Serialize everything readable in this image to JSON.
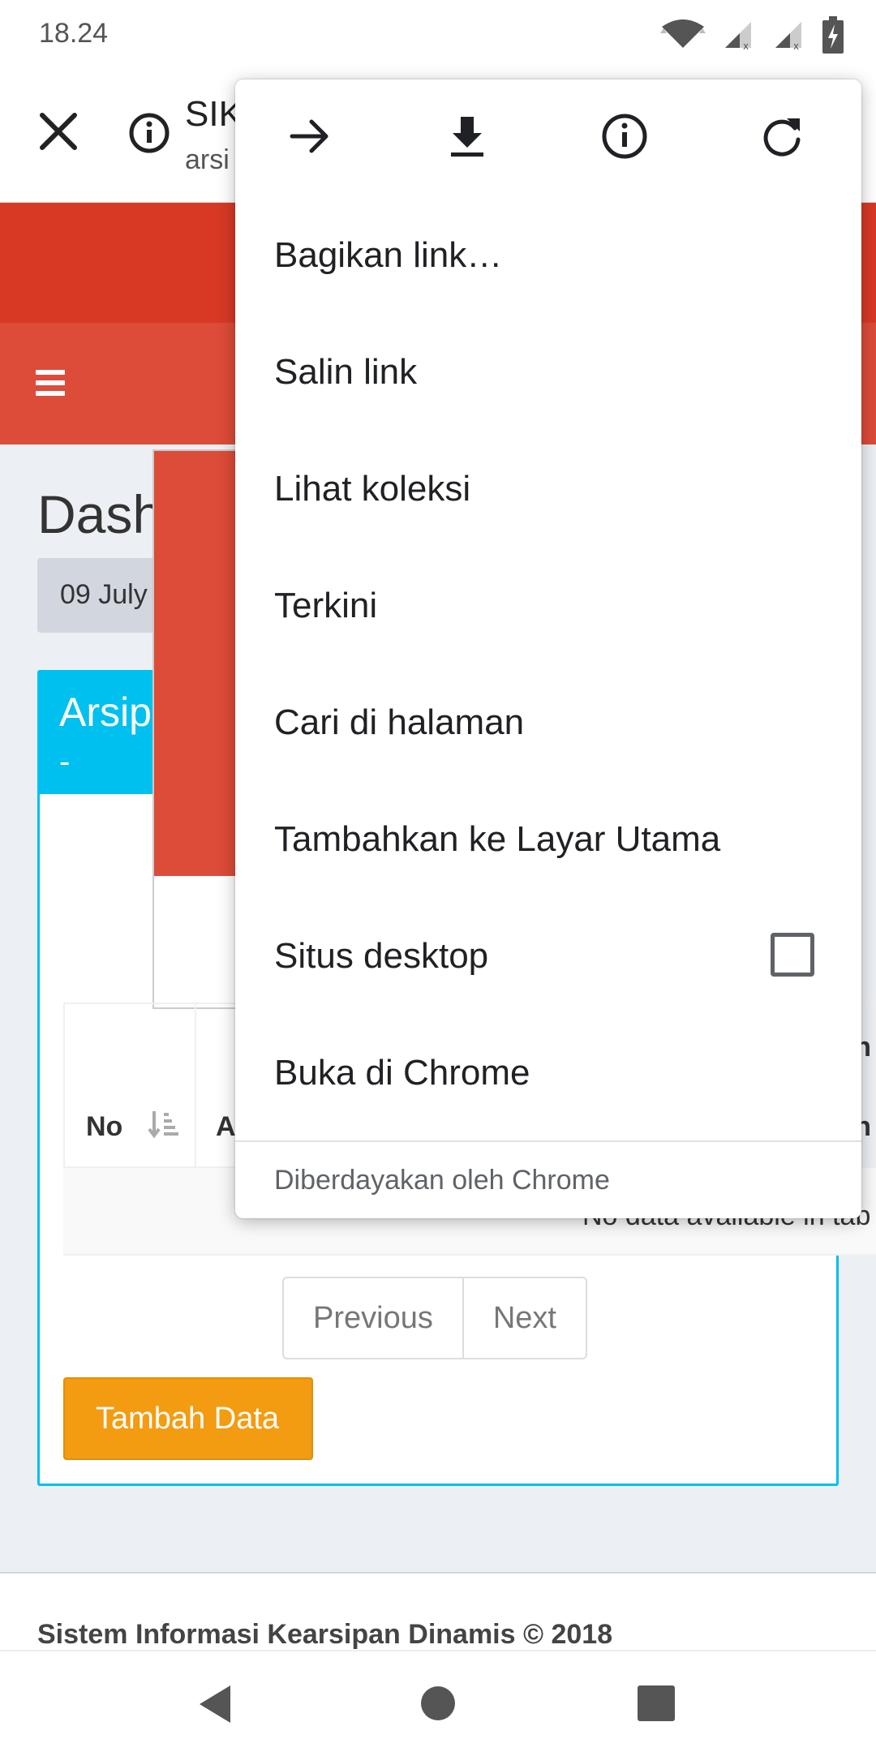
{
  "status_bar": {
    "time": "18.24"
  },
  "toolbar": {
    "title": "SIK",
    "url": "arsi"
  },
  "page": {
    "heading": "Dash",
    "date": "09 July",
    "box_title": "Arsip",
    "box_subtitle": "-",
    "table": {
      "col_no": "No",
      "col_a": "A",
      "col_edge_top": "n",
      "col_edge_bottom": "n",
      "empty_text": "No data available in tab"
    },
    "pager": {
      "previous": "Previous",
      "next": "Next"
    },
    "add_button": "Tambah Data",
    "footer": "Sistem Informasi Kearsipan Dinamis © 2018"
  },
  "menu": {
    "icons": [
      "arrow-forward-icon",
      "download-icon",
      "info-icon",
      "refresh-icon"
    ],
    "items": [
      {
        "label": "Bagikan link…"
      },
      {
        "label": "Salin link"
      },
      {
        "label": "Lihat koleksi"
      },
      {
        "label": "Terkini"
      },
      {
        "label": "Cari di halaman"
      },
      {
        "label": "Tambahkan ke Layar Utama"
      },
      {
        "label": "Situs desktop",
        "checked": false
      },
      {
        "label": "Buka di Chrome"
      }
    ],
    "footer": "Diberdayakan oleh Chrome"
  },
  "colors": {
    "header_dark_red": "#d73925",
    "header_red": "#dd4b39",
    "info_box": "#00c0ef",
    "add_button": "#f39c12"
  }
}
